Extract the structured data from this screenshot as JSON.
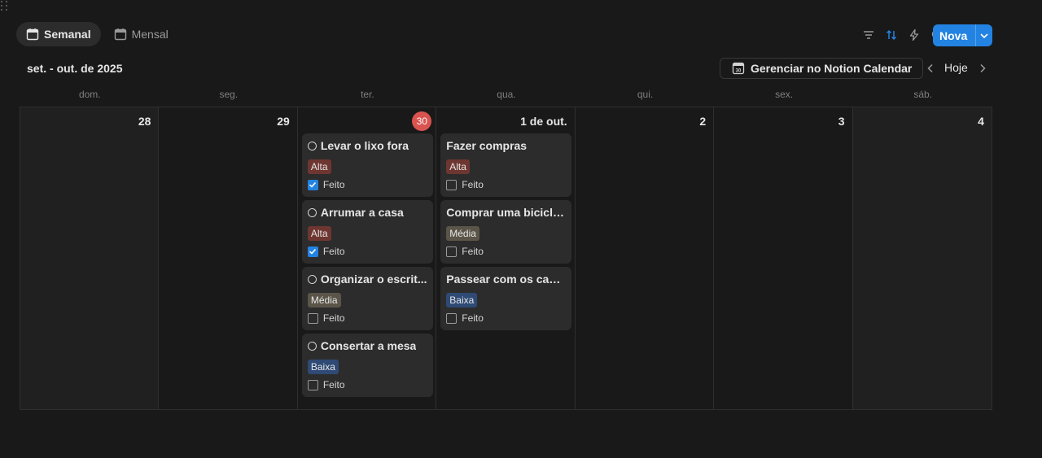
{
  "views": {
    "weekly": "Semanal",
    "monthly": "Mensal"
  },
  "toolbar": {
    "icons": [
      "filter-icon",
      "sort-icon",
      "lightning-icon",
      "search-icon",
      "expand-icon",
      "settings-icon"
    ],
    "new_label": "Nova",
    "accent": "#2383e2"
  },
  "calendar": {
    "range_title": "set. - out. de 2025",
    "manage_label": "Gerenciar no Notion Calendar",
    "today_label": "Hoje",
    "day_headers": [
      "dom.",
      "seg.",
      "ter.",
      "qua.",
      "qui.",
      "sex.",
      "sáb."
    ],
    "dates": [
      "28",
      "29",
      "30",
      "1 de out.",
      "2",
      "3",
      "4"
    ],
    "today_color": "#d9534f"
  },
  "tasks": {
    "tue": [
      {
        "title": "Levar o lixo fora",
        "priority": "Alta",
        "done_label": "Feito",
        "done": true
      },
      {
        "title": "Arrumar a casa",
        "priority": "Alta",
        "done_label": "Feito",
        "done": true
      },
      {
        "title": "Organizar o escrit...",
        "priority": "Média",
        "done_label": "Feito",
        "done": false
      },
      {
        "title": "Consertar a mesa",
        "priority": "Baixa",
        "done_label": "Feito",
        "done": false
      }
    ],
    "wed": [
      {
        "title": "Fazer compras",
        "priority": "Alta",
        "done_label": "Feito",
        "done": false
      },
      {
        "title": "Comprar uma bicicleta",
        "priority": "Média",
        "done_label": "Feito",
        "done": false
      },
      {
        "title": "Passear com os cach...",
        "priority": "Baixa",
        "done_label": "Feito",
        "done": false
      }
    ]
  }
}
